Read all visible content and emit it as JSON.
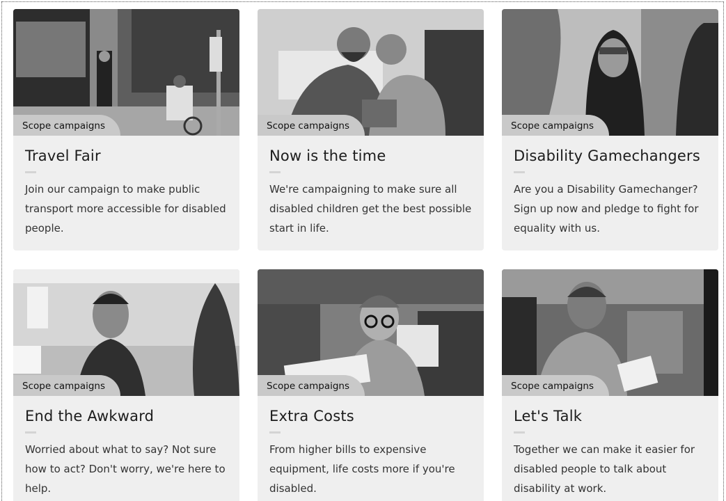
{
  "cards": [
    {
      "tag": "Scope campaigns",
      "title": "Travel Fair",
      "description": "Join our campaign to make public transport more accessible for disabled people.",
      "image_icon": "photo-bus-stop-wheelchair"
    },
    {
      "tag": "Scope campaigns",
      "title": "Now is the time",
      "description": "We're campaigning to make sure all disabled children get the best possible start in life.",
      "image_icon": "photo-father-son-playing"
    },
    {
      "tag": "Scope campaigns",
      "title": "Disability Gamechangers",
      "description": "Are you a Disability Gamechanger? Sign up now and pledge to fight for equality with us.",
      "image_icon": "photo-group-laughing"
    },
    {
      "tag": "Scope campaigns",
      "title": "End the Awkward",
      "description": "Worried about what to say? Not sure how to act? Don't worry, we're here to help.",
      "image_icon": "photo-office-man-surprised"
    },
    {
      "tag": "Scope campaigns",
      "title": "Extra Costs",
      "description": "From higher bills to expensive equipment, life costs more if you're disabled.",
      "image_icon": "photo-woman-reading-bills"
    },
    {
      "tag": "Scope campaigns",
      "title": "Let's Talk",
      "description": "Together we can make it easier for disabled people to talk about disability at work.",
      "image_icon": "photo-man-at-work-desk"
    }
  ]
}
